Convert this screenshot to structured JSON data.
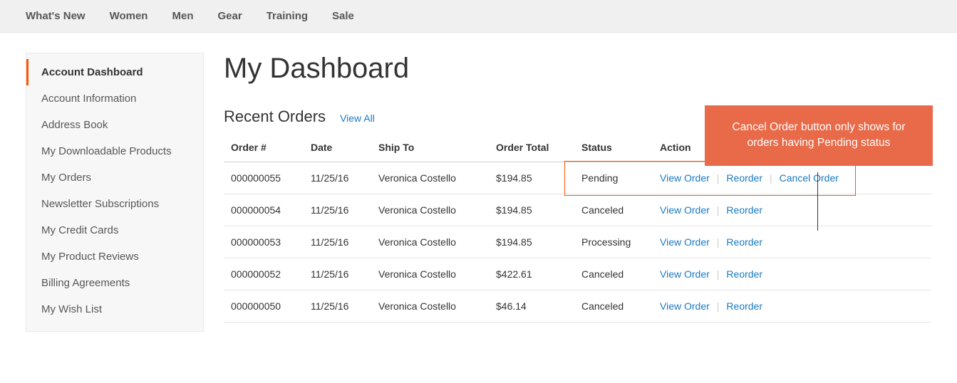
{
  "top_nav": {
    "items": [
      {
        "label": "What's New"
      },
      {
        "label": "Women"
      },
      {
        "label": "Men"
      },
      {
        "label": "Gear"
      },
      {
        "label": "Training"
      },
      {
        "label": "Sale"
      }
    ]
  },
  "sidebar": {
    "items": [
      {
        "label": "Account Dashboard",
        "active": true
      },
      {
        "label": "Account Information"
      },
      {
        "label": "Address Book"
      },
      {
        "label": "My Downloadable Products"
      },
      {
        "label": "My Orders"
      },
      {
        "label": "Newsletter Subscriptions"
      },
      {
        "label": "My Credit Cards"
      },
      {
        "label": "My Product Reviews"
      },
      {
        "label": "Billing Agreements"
      },
      {
        "label": "My Wish List"
      }
    ]
  },
  "main": {
    "title": "My Dashboard",
    "recent_orders_title": "Recent Orders",
    "view_all_label": "View All",
    "columns": {
      "order": "Order #",
      "date": "Date",
      "ship_to": "Ship To",
      "total": "Order Total",
      "status": "Status",
      "action": "Action"
    },
    "action_labels": {
      "view": "View Order",
      "reorder": "Reorder",
      "cancel": "Cancel Order"
    },
    "orders": [
      {
        "order": "000000055",
        "date": "11/25/16",
        "ship_to": "Veronica Costello",
        "total": "$194.85",
        "status": "Pending",
        "cancelable": true
      },
      {
        "order": "000000054",
        "date": "11/25/16",
        "ship_to": "Veronica Costello",
        "total": "$194.85",
        "status": "Canceled",
        "cancelable": false
      },
      {
        "order": "000000053",
        "date": "11/25/16",
        "ship_to": "Veronica Costello",
        "total": "$194.85",
        "status": "Processing",
        "cancelable": false
      },
      {
        "order": "000000052",
        "date": "11/25/16",
        "ship_to": "Veronica Costello",
        "total": "$422.61",
        "status": "Canceled",
        "cancelable": false
      },
      {
        "order": "000000050",
        "date": "11/25/16",
        "ship_to": "Veronica Costello",
        "total": "$46.14",
        "status": "Canceled",
        "cancelable": false
      }
    ]
  },
  "callout": {
    "text": "Cancel Order button only shows for orders having Pending status"
  }
}
